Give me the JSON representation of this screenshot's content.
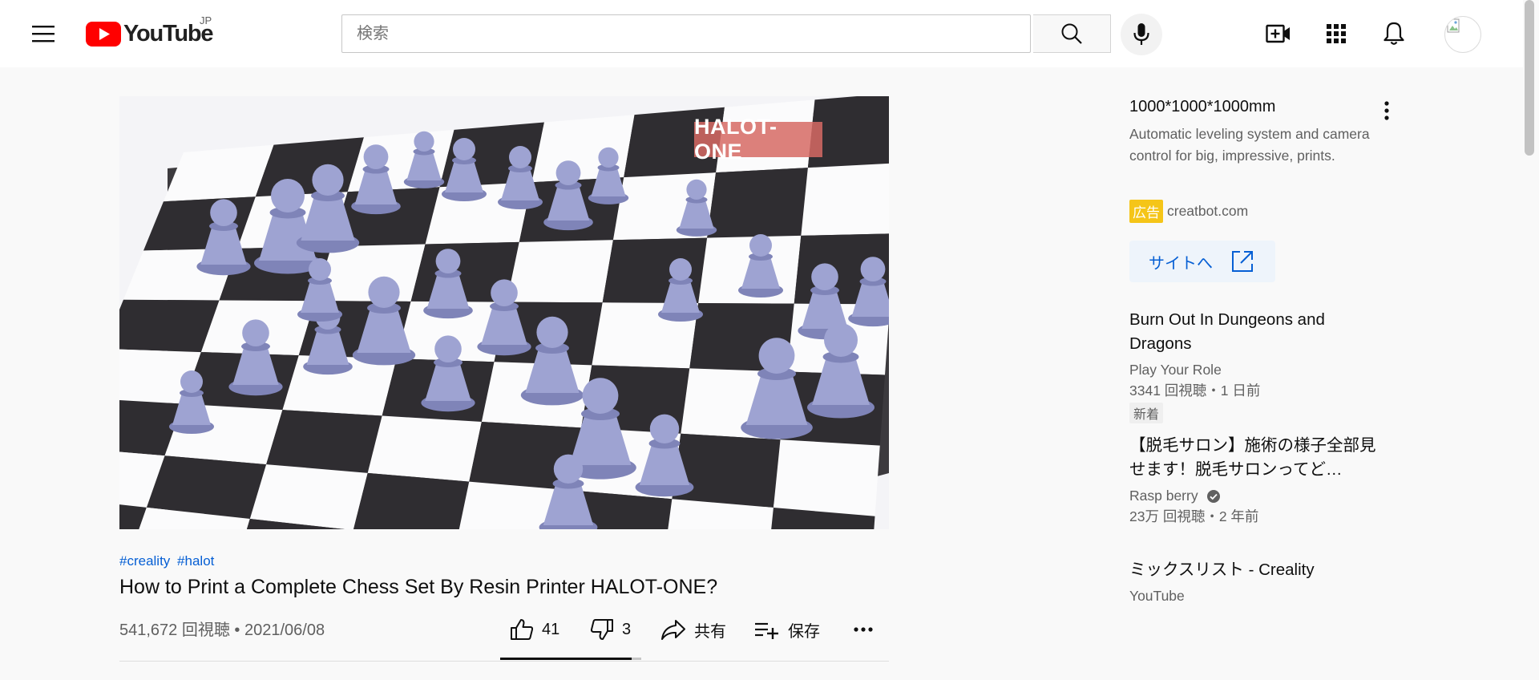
{
  "header": {
    "logo_text": "YouTube",
    "country_code": "JP",
    "search_placeholder": "検索",
    "brand_color": "#ff0000"
  },
  "video": {
    "watermark": "HALOT-ONE",
    "hashtags": [
      "#creality",
      "#halot"
    ],
    "title": "How to Print a Complete Chess Set By Resin Printer HALOT-ONE?",
    "meta": "541,672 回視聴 • 2021/06/08",
    "likes": "41",
    "dislikes": "3",
    "share_label": "共有",
    "save_label": "保存",
    "like_ratio": 0.93
  },
  "sidebar": {
    "ad": {
      "title": "1000*1000*1000mm",
      "description": "Automatic leveling system and camera control for big, impressive, prints.",
      "badge": "広告",
      "domain": "creatbot.com",
      "button_label": "サイトへ"
    },
    "recommendations": [
      {
        "title": "Burn Out In Dungeons and Dragons",
        "channel": "Play Your Role",
        "stats": "3341 回視聴・1 日前",
        "badge": "新着"
      },
      {
        "title": "【脱毛サロン】施術の様子全部見せます！脱毛サロンってど…",
        "channel": "Rasp berry",
        "stats": "23万 回視聴・2 年前"
      },
      {
        "title": "ミックスリスト - Creality",
        "channel": "YouTube"
      }
    ]
  }
}
